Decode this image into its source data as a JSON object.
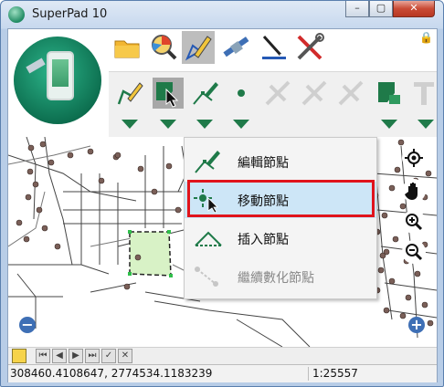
{
  "app": {
    "title": "SuperPad 10"
  },
  "window_controls": {
    "minimize": "–",
    "restore": "▢",
    "close": "✕"
  },
  "tabs": [
    {
      "icon": "folder-icon"
    },
    {
      "icon": "query-icon"
    },
    {
      "icon": "edit-icon",
      "active": true
    },
    {
      "icon": "gps-icon"
    },
    {
      "icon": "measure-icon"
    },
    {
      "icon": "tools-icon"
    }
  ],
  "edit_tools": [
    {
      "icon": "draw-line-icon"
    },
    {
      "icon": "move-vertex-icon",
      "active": true
    },
    {
      "icon": "edit-vertex-icon"
    },
    {
      "icon": "point-icon"
    },
    {
      "icon": "disabled-tool-icon"
    },
    {
      "icon": "disabled-tool-icon"
    },
    {
      "icon": "disabled-tool-icon"
    },
    {
      "icon": "polygon-edit-icon"
    },
    {
      "icon": "text-icon"
    }
  ],
  "dropdown_menu": {
    "items": [
      {
        "label": "編輯節點",
        "icon": "edit-vertex-icon",
        "state": "normal"
      },
      {
        "label": "移動節點",
        "icon": "move-vertex-icon",
        "state": "highlighted"
      },
      {
        "label": "插入節點",
        "icon": "insert-vertex-icon",
        "state": "normal"
      },
      {
        "label": "繼續數化節點",
        "icon": "continue-digitize-icon",
        "state": "disabled"
      }
    ]
  },
  "map_controls": [
    "locate-icon",
    "pan-hand-icon",
    "zoom-in-icon",
    "zoom-out-icon"
  ],
  "zoom": {
    "out": "−",
    "in": "+"
  },
  "status": {
    "coordinates": "308460.4108647, 2774534.1183239",
    "scale": "1:25557"
  },
  "colors": {
    "accent_green": "#1f7a49",
    "highlight_blue": "#cde6f7",
    "callout_red": "#e0141c",
    "selection_fill": "#d8f2c6"
  }
}
